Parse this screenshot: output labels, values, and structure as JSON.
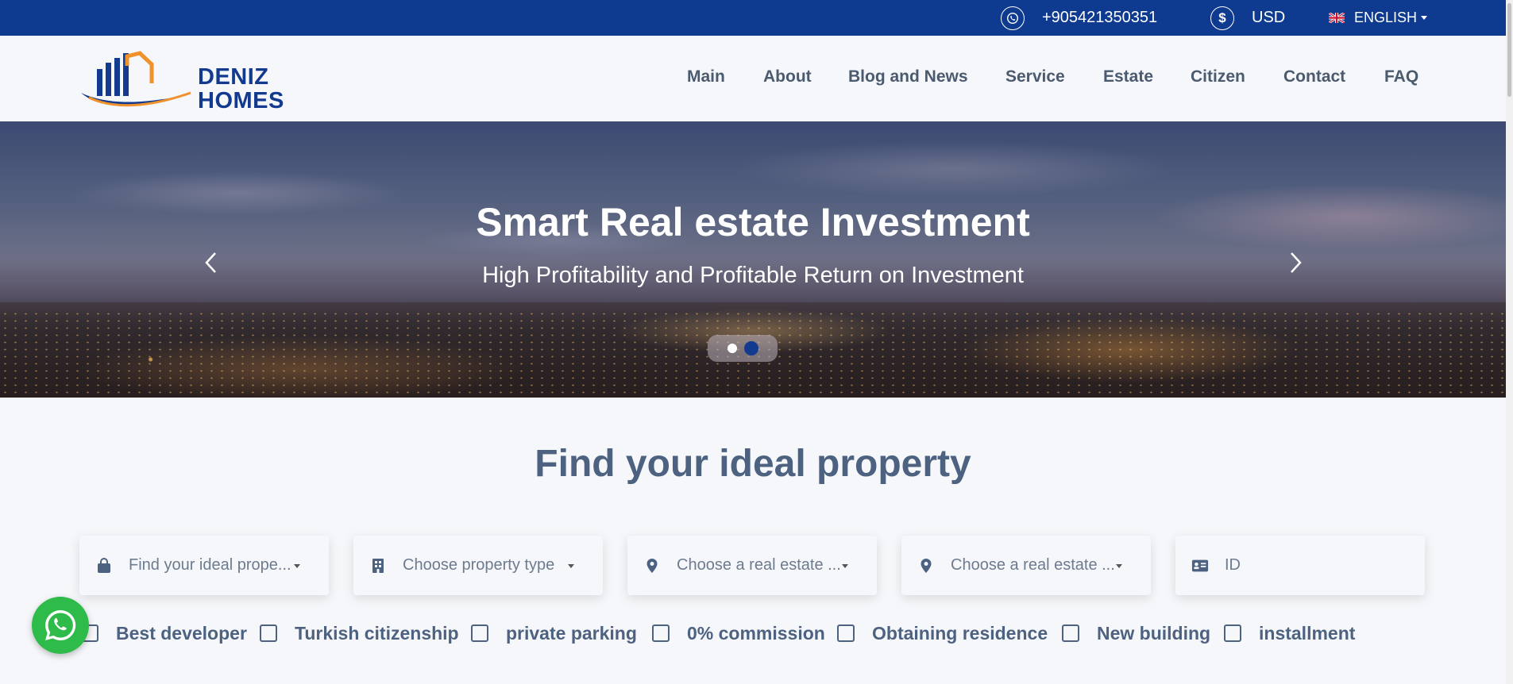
{
  "topbar": {
    "phone": "+905421350351",
    "currency": "USD",
    "currency_symbol": "$",
    "language": "ENGLISH",
    "bg_color": "#0e3a8f"
  },
  "header": {
    "logo_line1": "DENIZ",
    "logo_line2": "HOMES",
    "nav": [
      "Main",
      "About",
      "Blog and News",
      "Service",
      "Estate",
      "Citizen",
      "Contact",
      "FAQ"
    ]
  },
  "hero": {
    "title": "Smart Real estate Investment",
    "subtitle": "High Profitability and Profitable Return on Investment",
    "slide_count": 2,
    "active_slide": 2
  },
  "search": {
    "title": "Find your ideal property",
    "fields": [
      {
        "icon": "bag-icon",
        "placeholder": "Find your ideal prope..."
      },
      {
        "icon": "building-icon",
        "placeholder": "Choose property type"
      },
      {
        "icon": "location-pin-icon",
        "placeholder": "Choose a real estate ..."
      },
      {
        "icon": "location-pin-icon",
        "placeholder": "Choose a real estate ..."
      },
      {
        "icon": "id-card-icon",
        "placeholder": "ID"
      }
    ],
    "checkboxes": [
      "Best developer",
      "Turkish citizenship",
      "private parking",
      "0% commission",
      "Obtaining residence",
      "New building",
      "installment"
    ]
  },
  "colors": {
    "brand_blue": "#123a8e",
    "accent_orange": "#f0922b",
    "text_slate": "#4d6280",
    "whatsapp_green": "#2fbb4a"
  }
}
